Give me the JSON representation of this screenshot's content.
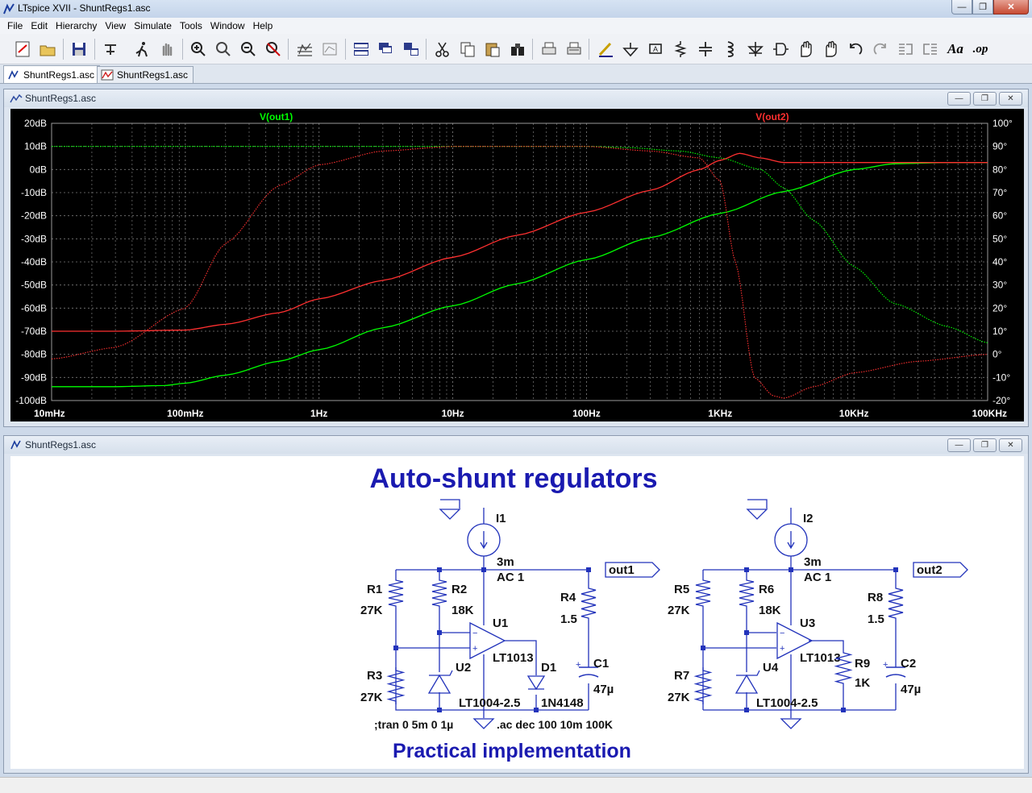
{
  "window": {
    "title": "LTspice XVII - ShuntRegs1.asc"
  },
  "menu": [
    "File",
    "Edit",
    "Hierarchy",
    "View",
    "Simulate",
    "Tools",
    "Window",
    "Help"
  ],
  "toolbar": {
    "buttons": [
      "new-schematic-icon",
      "open-icon",
      "save-icon",
      "control-panel-icon",
      "run-icon",
      "halt-icon",
      "zoom-in-icon",
      "zoom-box-icon",
      "zoom-out-icon",
      "zoom-cancel-icon",
      "autorange-icon",
      "view-fit-icon",
      "tile-horizontal-icon",
      "cascade-icon",
      "tile-vertical-icon",
      "cut-icon",
      "copy-icon",
      "paste-icon",
      "find-icon",
      "print-icon",
      "print-preview-icon",
      "draw-wire-icon",
      "ground-icon",
      "label-net-icon",
      "resistor-icon",
      "capacitor-icon",
      "inductor-icon",
      "diode-icon",
      "component-icon",
      "move-icon",
      "drag-icon",
      "undo-icon",
      "redo-icon",
      "rotate-icon",
      "mirror-icon",
      "text-icon",
      "spice-directive-icon"
    ],
    "text_aa": "Aa",
    "text_op": ".op"
  },
  "tabs": [
    {
      "label": "ShuntRegs1.asc",
      "active": true
    },
    {
      "label": "ShuntRegs1.asc",
      "active": false
    }
  ],
  "plot_window": {
    "title": "ShuntRegs1.asc"
  },
  "schematic_window": {
    "title": "ShuntRegs1.asc"
  },
  "chart_data": {
    "type": "line",
    "x_scale": "log",
    "xlim": [
      0.01,
      100000
    ],
    "x_ticks": [
      "10mHz",
      "100mHz",
      "1Hz",
      "10Hz",
      "100Hz",
      "1KHz",
      "10KHz",
      "100KHz"
    ],
    "y_left_ticks": [
      "20dB",
      "10dB",
      "0dB",
      "-10dB",
      "-20dB",
      "-30dB",
      "-40dB",
      "-50dB",
      "-60dB",
      "-70dB",
      "-80dB",
      "-90dB",
      "-100dB"
    ],
    "y_right_ticks": [
      "100°",
      "90°",
      "80°",
      "70°",
      "60°",
      "50°",
      "40°",
      "30°",
      "20°",
      "10°",
      "0°",
      "-10°",
      "-20°"
    ],
    "ylim_db": [
      -100,
      20
    ],
    "ylim_deg": [
      -20,
      100
    ],
    "grid": true,
    "series": [
      {
        "name": "V(out1)",
        "color": "#00ff00",
        "quantity": "magnitude",
        "x": [
          0.01,
          0.03,
          0.07,
          0.1,
          0.2,
          0.5,
          1,
          3,
          10,
          30,
          100,
          300,
          1000,
          3000,
          10000,
          20000,
          50000,
          100000
        ],
        "y": [
          -94,
          -94,
          -93.5,
          -92.5,
          -89,
          -83,
          -78,
          -68.5,
          -59,
          -49.5,
          -39,
          -29.5,
          -19,
          -9.5,
          0,
          2.5,
          3,
          3
        ]
      },
      {
        "name": "V(out1)",
        "color": "#00ff00",
        "quantity": "phase",
        "x": [
          0.01,
          1,
          10,
          100,
          200,
          500,
          1000,
          2000,
          3000,
          5000,
          10000,
          20000,
          50000,
          100000
        ],
        "y": [
          90,
          90,
          90,
          90,
          89.5,
          88,
          85,
          80,
          72,
          58,
          38,
          22,
          12,
          5
        ]
      },
      {
        "name": "V(out2)",
        "color": "#ff3030",
        "quantity": "magnitude",
        "x": [
          0.01,
          0.03,
          0.1,
          0.2,
          0.5,
          1,
          3,
          10,
          30,
          100,
          300,
          700,
          1000,
          1400,
          2000,
          3000,
          5000,
          10000,
          30000,
          100000
        ],
        "y": [
          -70,
          -70,
          -69.5,
          -67,
          -62,
          -56,
          -48,
          -38,
          -28.5,
          -18.5,
          -9,
          0,
          4,
          7,
          5,
          3,
          3,
          3,
          3,
          3
        ]
      },
      {
        "name": "V(out2)",
        "color": "#ff3030",
        "quantity": "phase",
        "x": [
          0.01,
          0.03,
          0.1,
          0.2,
          0.5,
          1,
          3,
          10,
          30,
          100,
          300,
          700,
          1000,
          1300,
          1800,
          2500,
          3000,
          5000,
          10000,
          30000,
          100000
        ],
        "y": [
          -2,
          3,
          20,
          48,
          73,
          82,
          88,
          90,
          90,
          90,
          88,
          85,
          75,
          40,
          -10,
          -18,
          -19,
          -14,
          -8,
          -3,
          0
        ]
      }
    ]
  },
  "schematic": {
    "title": "Auto-shunt regulators",
    "subtitle": "Practical implementation",
    "directives": [
      ";tran 0 5m 0 1µ",
      ".ac dec 100 10m 100K"
    ],
    "left": {
      "source": "I1",
      "source_value": "3m",
      "source_ac": "AC 1",
      "out_label": "out1",
      "R_top_a": "R1",
      "R_top_a_val": "27K",
      "R_top_b": "R2",
      "R_top_b_val": "18K",
      "R_bot": "R3",
      "R_bot_val": "27K",
      "R_series": "R4",
      "R_series_val": "1.5",
      "opamp": "U1",
      "opamp_part": "LT1013",
      "ref": "U2",
      "ref_part": "LT1004-2.5",
      "diode": "D1",
      "diode_part": "1N4148",
      "cap": "C1",
      "cap_val": "47µ"
    },
    "right": {
      "source": "I2",
      "source_value": "3m",
      "source_ac": "AC 1",
      "out_label": "out2",
      "R_top_a": "R5",
      "R_top_a_val": "27K",
      "R_top_b": "R6",
      "R_top_b_val": "18K",
      "R_bot": "R7",
      "R_bot_val": "27K",
      "R_series": "R8",
      "R_series_val": "1.5",
      "opamp": "U3",
      "opamp_part": "LT1013",
      "ref": "U4",
      "ref_part": "LT1004-2.5",
      "res9": "R9",
      "res9_val": "1K",
      "cap": "C2",
      "cap_val": "47µ"
    }
  }
}
